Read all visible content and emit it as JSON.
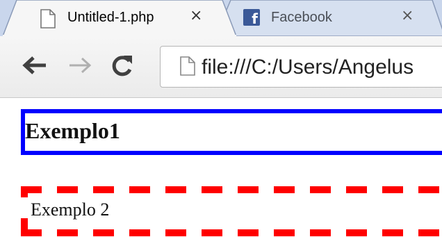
{
  "browser": {
    "tabs": [
      {
        "title": "Untitled-1.php",
        "close_glyph": "×",
        "icon": "page-icon",
        "active": true
      },
      {
        "title": "Facebook",
        "close_glyph": "×",
        "icon": "facebook-icon",
        "active": false
      }
    ],
    "toolbar": {
      "back_icon": "back-arrow-icon",
      "forward_icon": "forward-arrow-icon",
      "reload_icon": "reload-icon",
      "url": "file:///C:/Users/Angelus"
    },
    "colors": {
      "tabstrip": "#c9d6ec",
      "facebook": "#3b5998"
    }
  },
  "page": {
    "example1": {
      "text": "Exemplo1",
      "border_color": "#0000ff",
      "border_style": "solid"
    },
    "example2": {
      "text": "Exemplo 2",
      "border_color": "#ff0000",
      "border_style": "dashed"
    }
  }
}
